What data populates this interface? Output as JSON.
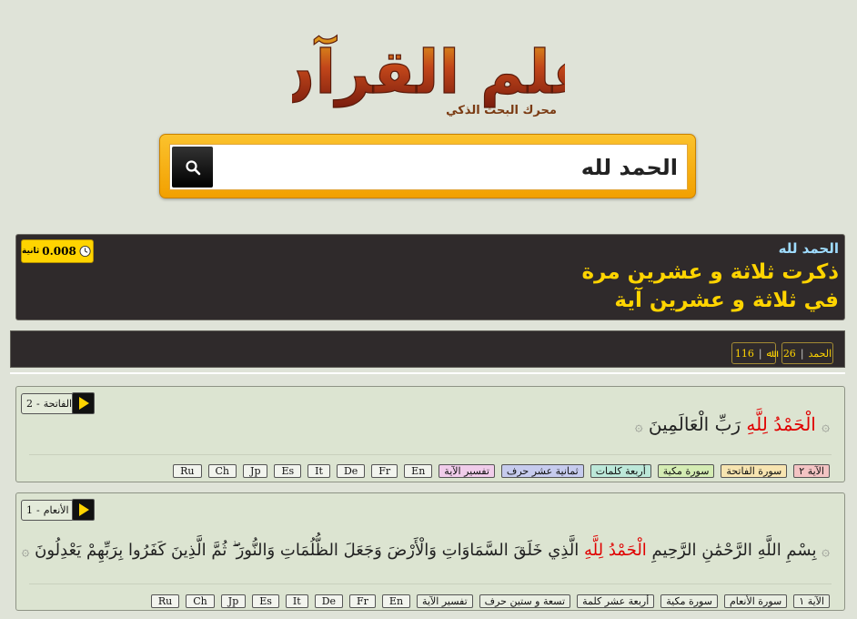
{
  "logo": {
    "title": "علم القرآن",
    "subtitle": "محرك البحث الذكي"
  },
  "search": {
    "value": "الحمد لله",
    "button_icon": "search-icon"
  },
  "summary": {
    "query": "الحمد لله",
    "line1": "ذكرت ثلاثة و عشرين مرة",
    "line2": "في ثلاثة و عشرين آية",
    "timer": {
      "value": "0.008",
      "unit": "ثانية",
      "icon": "clock-icon"
    }
  },
  "stats": [
    {
      "label": "الحمد",
      "count": "26"
    },
    {
      "label": "ﷲ",
      "count": "116"
    }
  ],
  "results": [
    {
      "ref": {
        "surah": "الفاتحة",
        "num": "2"
      },
      "verse": {
        "before": "",
        "highlight": "الْحَمْدُ لِلَّهِ",
        "after": "رَبِّ الْعَالَمِينَ"
      },
      "tags": [
        "الآية ٢",
        "سورة الفاتحة",
        "سورة مكية",
        "أربعة كلمات",
        "ثمانية عشر حرف",
        "تفسير الآية"
      ],
      "langs": [
        "En",
        "Fr",
        "De",
        "It",
        "Es",
        "Jp",
        "Ch",
        "Ru"
      ]
    },
    {
      "ref": {
        "surah": "الأنعام",
        "num": "1"
      },
      "verse": {
        "before": "بِسْمِ اللَّهِ الرَّحْمَٰنِ الرَّحِيمِ",
        "highlight": "الْحَمْدُ لِلَّهِ",
        "after": "الَّذِي خَلَقَ السَّمَاوَاتِ وَالْأَرْضَ وَجَعَلَ الظُّلُمَاتِ وَالنُّورَ ۖ ثُمَّ الَّذِينَ كَفَرُوا بِرَبِّهِمْ يَعْدِلُونَ"
      },
      "tags": [
        "الآية ١",
        "سورة الأنعام",
        "سورة مكية",
        "أربعة عشر كلمة",
        "تسعة و ستين حرف",
        "تفسير الآية"
      ],
      "langs": [
        "En",
        "Fr",
        "De",
        "It",
        "Es",
        "Jp",
        "Ch",
        "Ru"
      ]
    }
  ],
  "colors": {
    "accent": "#ffd400",
    "highlight": "#e00000",
    "panel": "#2f2a2b"
  }
}
